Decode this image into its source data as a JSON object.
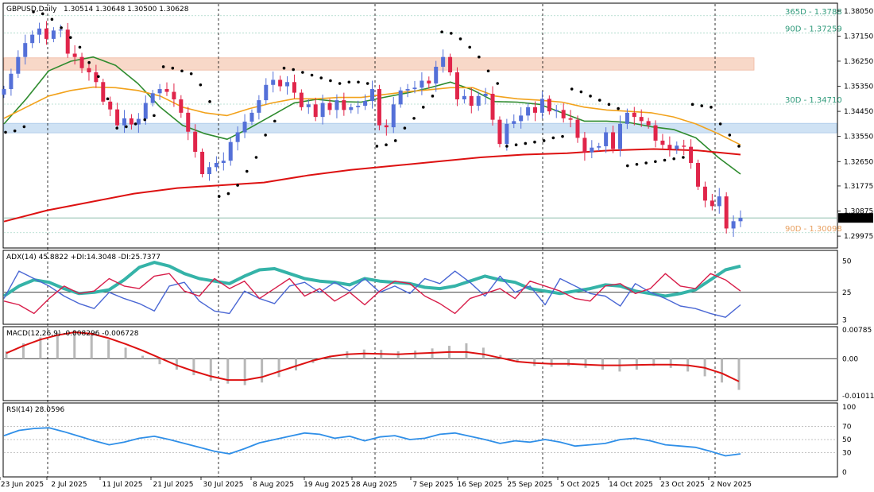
{
  "header": {
    "symbol_label": "GBPUSD,Daily",
    "ohlc_label": "1.30514 1.30648 1.30500 1.30628"
  },
  "colors": {
    "bull": "#5470d8",
    "bear": "#e0254a",
    "ma_green": "#2e8b2e",
    "ma_orange": "#f2a21b",
    "ma_red": "#dd1111",
    "sar": "#000000",
    "adx": "#35b3a8",
    "di_plus": "#4a67d4",
    "di_minus": "#d81e4a",
    "macd_hist": "#b8b8b8",
    "macd_signal": "#dd1111",
    "rsi": "#2f8fe8",
    "zone_resistance": "#f8d8c8",
    "zone_support": "#cfe2f4",
    "level_text": "#2e9a7a"
  },
  "chart_data": [
    {
      "type": "candlestick",
      "title": "GBPUSD,Daily",
      "ylim": [
        1.2955,
        1.3833
      ],
      "y_ticks": [
        "1.38050",
        "1.37150",
        "1.36250",
        "1.35350",
        "1.34450",
        "1.33550",
        "1.32650",
        "1.31775",
        "1.30875",
        "1.29975"
      ],
      "last_price": "1.30628",
      "x_ticks": [
        "23 Jun 2025",
        "2 Jul 2025",
        "11 Jul 2025",
        "21 Jul 2025",
        "30 Jul 2025",
        "8 Aug 2025",
        "19 Aug 2025",
        "28 Aug 2025",
        "7 Sep 2025",
        "16 Sep 2025",
        "25 Sep 2025",
        "5 Oct 2025",
        "14 Oct 2025",
        "23 Oct 2025",
        "2 Nov 2025"
      ],
      "levels": [
        {
          "label": "365D - 1.3788",
          "value": 1.3788
        },
        {
          "label": "90D - 1.37259",
          "value": 1.37259
        },
        {
          "label": "30D - 1.34710",
          "value": 1.3471
        },
        {
          "label": "90D - 1.30098",
          "value": 1.30098
        }
      ],
      "zones": [
        {
          "name": "resistance",
          "from": 1.3593,
          "to": 1.3637
        },
        {
          "name": "support",
          "from": 1.3368,
          "to": 1.3402
        }
      ],
      "candle_closes": [
        1.3525,
        1.358,
        1.364,
        1.369,
        1.372,
        1.3742,
        1.3705,
        1.3735,
        1.3738,
        1.3652,
        1.364,
        1.36,
        1.3585,
        1.355,
        1.348,
        1.3452,
        1.3395,
        1.342,
        1.3398,
        1.3418,
        1.3475,
        1.351,
        1.3525,
        1.3515,
        1.3488,
        1.344,
        1.3372,
        1.33,
        1.322,
        1.3245,
        1.326,
        1.3268,
        1.3335,
        1.337,
        1.3408,
        1.344,
        1.3485,
        1.354,
        1.3558,
        1.3535,
        1.355,
        1.3512,
        1.346,
        1.347,
        1.3425,
        1.3475,
        1.345,
        1.3485,
        1.345,
        1.346,
        1.3465,
        1.3482,
        1.3525,
        1.3395,
        1.3388,
        1.347,
        1.352,
        1.3525,
        1.353,
        1.3555,
        1.3545,
        1.3605,
        1.364,
        1.3585,
        1.3488,
        1.35,
        1.3465,
        1.35,
        1.3508,
        1.3415,
        1.3328,
        1.34,
        1.341,
        1.343,
        1.346,
        1.344,
        1.349,
        1.3445,
        1.345,
        1.342,
        1.3415,
        1.335,
        1.3298,
        1.3315,
        1.332,
        1.337,
        1.331,
        1.34,
        1.344,
        1.3425,
        1.341,
        1.3395,
        1.334,
        1.3325,
        1.331,
        1.3322,
        1.3318,
        1.326,
        1.3175,
        1.3125,
        1.3105,
        1.314,
        1.3025,
        1.3051,
        1.30628
      ],
      "series": [
        {
          "name": "green_ma",
          "values": [
            1.34,
            1.349,
            1.359,
            1.3625,
            1.364,
            1.361,
            1.3545,
            1.346,
            1.3395,
            1.3365,
            1.3345,
            1.3385,
            1.343,
            1.3475,
            1.3488,
            1.348,
            1.3478,
            1.3495,
            1.351,
            1.3528,
            1.355,
            1.3522,
            1.348,
            1.3478,
            1.347,
            1.344,
            1.341,
            1.341,
            1.3405,
            1.339,
            1.338,
            1.335,
            1.328,
            1.322
          ]
        },
        {
          "name": "orange_ma",
          "values": [
            1.342,
            1.346,
            1.35,
            1.352,
            1.3532,
            1.353,
            1.352,
            1.35,
            1.346,
            1.344,
            1.343,
            1.3455,
            1.3475,
            1.349,
            1.349,
            1.3495,
            1.3495,
            1.3505,
            1.3515,
            1.3522,
            1.353,
            1.353,
            1.35,
            1.349,
            1.3485,
            1.3478,
            1.346,
            1.345,
            1.3445,
            1.344,
            1.3425,
            1.34,
            1.3365,
            1.3325
          ]
        },
        {
          "name": "red_ma",
          "values": [
            1.305,
            1.309,
            1.312,
            1.315,
            1.317,
            1.318,
            1.319,
            1.3215,
            1.3235,
            1.325,
            1.3265,
            1.328,
            1.329,
            1.3295,
            1.3305,
            1.331,
            1.3305,
            1.329
          ]
        }
      ],
      "sar": [
        1.337,
        1.3375,
        1.339,
        1.3802,
        1.3795,
        1.3775,
        1.3745,
        1.371,
        1.3675,
        1.362,
        1.357,
        1.349,
        1.3385,
        1.339,
        1.34,
        1.3415,
        1.343,
        1.3605,
        1.36,
        1.359,
        1.358,
        1.354,
        1.348,
        1.314,
        1.315,
        1.318,
        1.323,
        1.328,
        1.336,
        1.341,
        1.36,
        1.3595,
        1.3585,
        1.3575,
        1.3565,
        1.3555,
        1.3545,
        1.355,
        1.355,
        1.3545,
        1.332,
        1.3325,
        1.334,
        1.3385,
        1.342,
        1.346,
        1.35,
        1.373,
        1.3725,
        1.3705,
        1.3675,
        1.364,
        1.359,
        1.3545,
        1.332,
        1.3325,
        1.333,
        1.3335,
        1.334,
        1.335,
        1.3355,
        1.3525,
        1.3515,
        1.35,
        1.3485,
        1.347,
        1.3455,
        1.325,
        1.3255,
        1.326,
        1.3265,
        1.327,
        1.3275,
        1.328,
        1.347,
        1.3465,
        1.346,
        1.34,
        1.336,
        1.332
      ]
    },
    {
      "type": "line",
      "title": "ADX(14) 45.8822 +DI:14.3048 -DI:25.7377",
      "ylim": [
        0,
        58
      ],
      "y_ticks": [
        "50",
        "25",
        "3"
      ],
      "series": [
        {
          "name": "ADX",
          "values": [
            22,
            30,
            35,
            33,
            28,
            24,
            25,
            27,
            35,
            45,
            49,
            46,
            40,
            36,
            34,
            32,
            38,
            43,
            44,
            40,
            36,
            34,
            33,
            31,
            36,
            34,
            33,
            32,
            29,
            28,
            30,
            34,
            38,
            35,
            33,
            28,
            26,
            24,
            26,
            28,
            31,
            30,
            26,
            24,
            22,
            24,
            27,
            35,
            43,
            46
          ]
        },
        {
          "name": "+DI",
          "values": [
            20,
            42,
            36,
            30,
            22,
            16,
            12,
            25,
            20,
            16,
            10,
            30,
            33,
            18,
            10,
            8,
            26,
            20,
            16,
            30,
            33,
            25,
            33,
            26,
            36,
            25,
            30,
            24,
            36,
            32,
            42,
            33,
            22,
            38,
            25,
            30,
            15,
            36,
            30,
            24,
            22,
            14,
            32,
            25,
            20,
            14,
            12,
            8,
            5,
            15
          ]
        },
        {
          "name": "-DI",
          "values": [
            18,
            15,
            8,
            20,
            30,
            24,
            26,
            36,
            30,
            28,
            38,
            40,
            26,
            22,
            36,
            28,
            34,
            20,
            28,
            36,
            22,
            28,
            18,
            25,
            15,
            26,
            34,
            32,
            22,
            16,
            8,
            20,
            24,
            28,
            20,
            34,
            30,
            26,
            20,
            18,
            30,
            32,
            24,
            28,
            40,
            30,
            28,
            40,
            35,
            26
          ]
        }
      ]
    },
    {
      "type": "bar",
      "title": "MACD(12,26,9) -0.008296 -0.006728",
      "ylim": [
        -0.0112,
        0.0085
      ],
      "y_ticks": [
        "0.00785",
        "0.00",
        "-0.010113"
      ],
      "series": [
        {
          "name": "MACD",
          "values": [
            0.002,
            0.0042,
            0.0058,
            0.007,
            0.0078,
            0.007,
            0.0052,
            0.003,
            0.0008,
            -0.0015,
            -0.003,
            -0.0045,
            -0.006,
            -0.0068,
            -0.0072,
            -0.0065,
            -0.005,
            -0.0032,
            -0.0012,
            0.0008,
            0.002,
            0.0025,
            0.0024,
            0.002,
            0.0022,
            0.0028,
            0.0035,
            0.0042,
            0.003,
            0.001,
            -0.001,
            -0.002,
            -0.0022,
            -0.002,
            -0.0025,
            -0.003,
            -0.0035,
            -0.003,
            -0.002,
            -0.0025,
            -0.0035,
            -0.0048,
            -0.0065,
            -0.0085
          ]
        },
        {
          "name": "Signal",
          "values": [
            0.0015,
            0.0035,
            0.0052,
            0.0064,
            0.0072,
            0.0068,
            0.0056,
            0.004,
            0.0022,
            0.0002,
            -0.0018,
            -0.0034,
            -0.0048,
            -0.0058,
            -0.0058,
            -0.005,
            -0.0035,
            -0.002,
            -0.0005,
            0.0006,
            0.0012,
            0.0014,
            0.0013,
            0.0012,
            0.0014,
            0.0016,
            0.0018,
            0.0018,
            0.0012,
            0.0002,
            -0.0008,
            -0.0012,
            -0.0014,
            -0.0014,
            -0.0016,
            -0.0018,
            -0.0018,
            -0.0017,
            -0.0016,
            -0.0016,
            -0.0018,
            -0.0025,
            -0.004,
            -0.0062
          ]
        }
      ]
    },
    {
      "type": "line",
      "title": "RSI(14) 28.0596",
      "ylim": [
        0,
        100
      ],
      "y_ticks": [
        "100",
        "70",
        "50",
        "30",
        "0"
      ],
      "series": [
        {
          "name": "RSI",
          "values": [
            56,
            64,
            67,
            68,
            62,
            55,
            48,
            42,
            46,
            52,
            55,
            50,
            44,
            38,
            32,
            28,
            36,
            45,
            50,
            55,
            60,
            58,
            52,
            55,
            48,
            54,
            56,
            50,
            52,
            58,
            60,
            55,
            50,
            44,
            48,
            46,
            50,
            46,
            40,
            42,
            44,
            50,
            52,
            48,
            42,
            40,
            38,
            32,
            25,
            28
          ]
        }
      ]
    }
  ]
}
